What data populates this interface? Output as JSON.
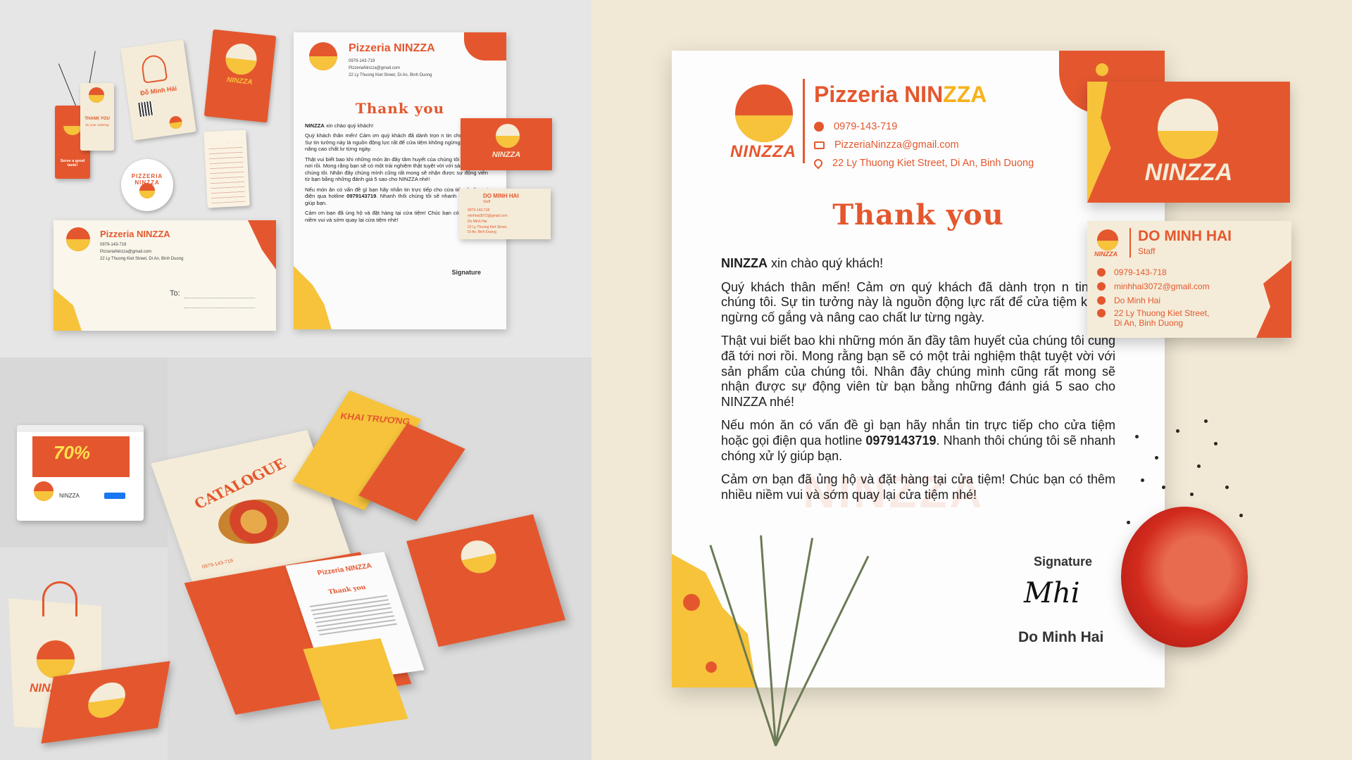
{
  "brand": {
    "name_prefix": "Pizzeria NIN",
    "name_suffix": "ZZA",
    "logo_word": "NINZZA",
    "phone": "0979-143-719",
    "email": "PizzeriaNinzza@gmail.com",
    "address": "22 Ly Thuong Kiet Street, Di An, Binh Duong",
    "colors": {
      "accent": "#e4572e",
      "yellow": "#f6c33b",
      "cream": "#f4ecd8"
    }
  },
  "letter": {
    "heading": "Thank you",
    "greeting_brand": "NINZZA",
    "greeting_rest": " xin chào quý khách!",
    "p1": "Quý khách thân mến! Cảm ơn quý khách đã dành trọn n tin cho chúng tôi. Sự tin tưởng này là nguồn động lực rất để cửa tiệm không ngừng cố gắng và nâng cao chất lư từng ngày.",
    "p2": "Thật vui biết bao khi những món ăn đầy tâm huyết của chúng tôi cũng đã tới nơi rồi. Mong rằng bạn sẽ có một trải nghiệm thật tuyệt vời với sản phẩm của chúng tôi. Nhân đây chúng mình cũng rất mong sẽ nhận được sự động viên từ bạn bằng những đánh giá 5 sao cho NINZZA nhé!",
    "p3_pre": "Nếu món ăn có vấn đề gì bạn hãy nhắn tin trực tiếp cho cửa tiệm hoặc gọi điện qua hotline ",
    "p3_hotline": "0979143719",
    "p3_post": ". Nhanh thôi chúng tôi sẽ nhanh chóng xử lý giúp bạn.",
    "p4": "Cảm ơn bạn đã ủng hộ và đặt hàng tại cửa tiệm! Chúc bạn có thêm nhiều niềm vui và sớm quay lại cửa tiệm nhé!",
    "signature_label": "Signature",
    "signer": "Do Minh Hai",
    "watermark": "NINZZA"
  },
  "business_card": {
    "name": "DO MINH HAI",
    "role": "Staff",
    "phone": "0979-143-718",
    "email": "minhhai3072@gmail.com",
    "facebook": "Do Minh Hai",
    "address_line1": "22 Ly Thuong Kiet Street,",
    "address_line2": "Di An, Binh Duong",
    "front_word": "NINZZA"
  },
  "mockups": {
    "tag_name": "Đỗ Minh Hải",
    "tag_thanks": "THANK YOU",
    "tag_thanks_sub": "for your ordering",
    "tag_slogan": "Serve a good taste!",
    "sticker_text": "PIZZERIA NINZZA",
    "envelope_to": "To:",
    "catalogue_title": "CATALOGUE",
    "flyer_title": "KHAI TRƯƠNG",
    "fb_discount": "70%",
    "fb_page_name": "NINZZA",
    "folder_title": "Pizzeria NINZZA",
    "folder_heading": "Thank you"
  }
}
